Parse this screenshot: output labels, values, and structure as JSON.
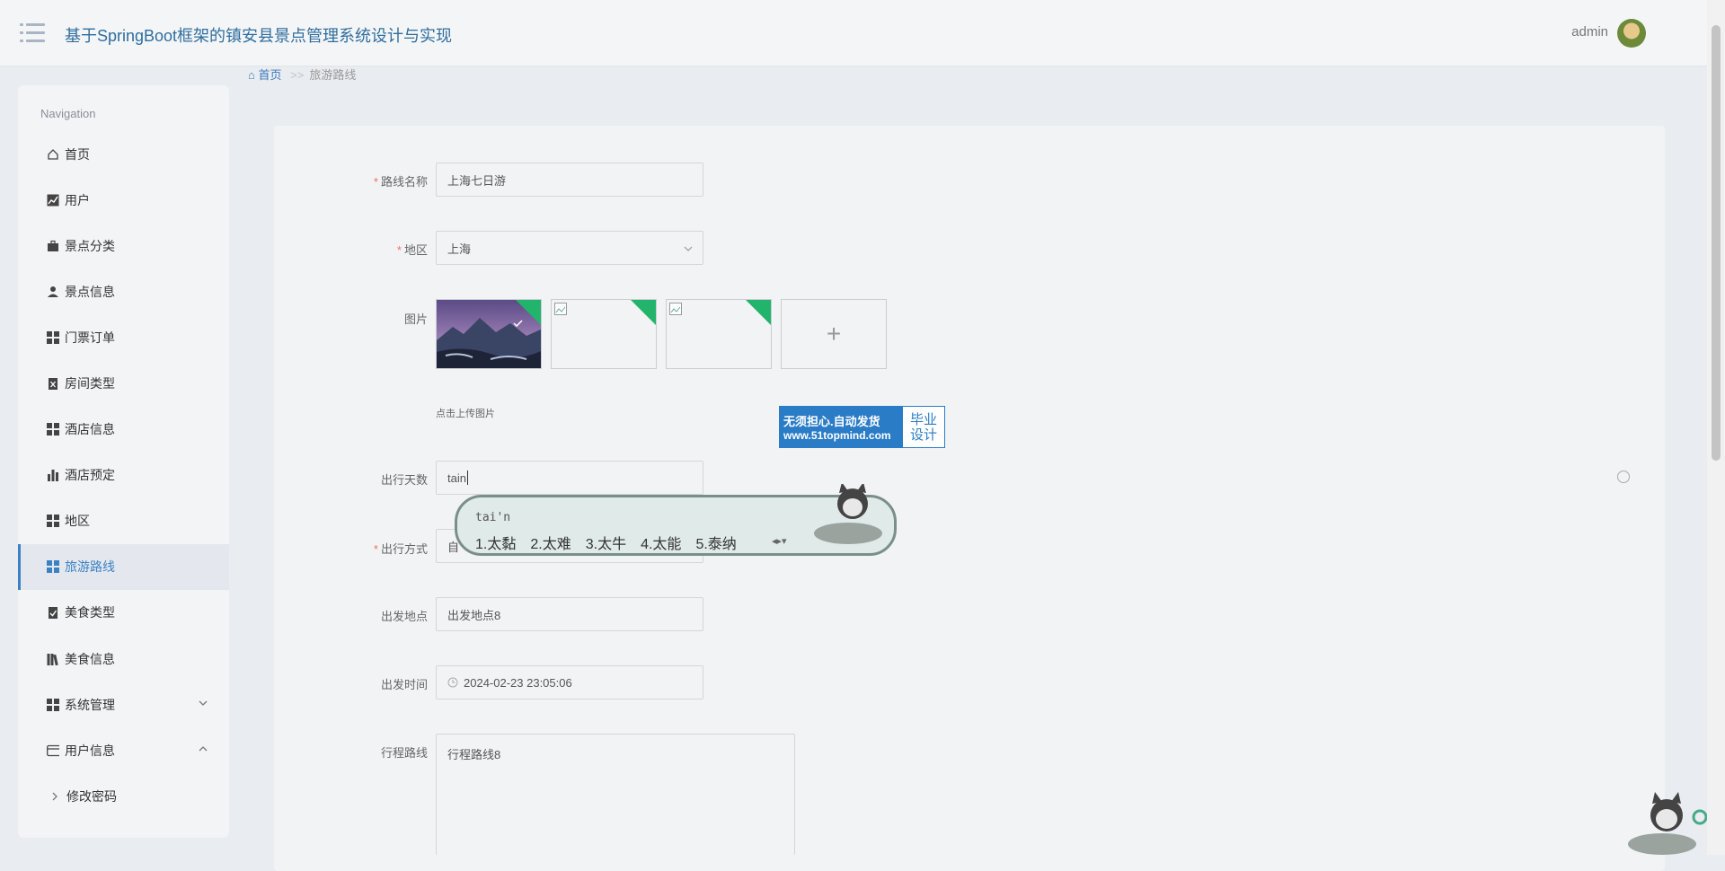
{
  "header": {
    "title": "基于SpringBoot框架的镇安县景点管理系统设计与实现",
    "user": "admin"
  },
  "breadcrumb": {
    "home": "首页",
    "separator": ">>",
    "current": "旅游路线"
  },
  "sidebar": {
    "title": "Navigation",
    "items": [
      {
        "label": "首页",
        "icon": "home-icon"
      },
      {
        "label": "用户",
        "icon": "chart-line-icon"
      },
      {
        "label": "景点分类",
        "icon": "briefcase-icon"
      },
      {
        "label": "景点信息",
        "icon": "person-icon"
      },
      {
        "label": "门票订单",
        "icon": "grid-icon"
      },
      {
        "label": "房间类型",
        "icon": "clipboard-icon"
      },
      {
        "label": "酒店信息",
        "icon": "grid-icon"
      },
      {
        "label": "酒店预定",
        "icon": "bar-chart-icon"
      },
      {
        "label": "地区",
        "icon": "grid-icon"
      },
      {
        "label": "旅游路线",
        "icon": "grid-icon",
        "active": true
      },
      {
        "label": "美食类型",
        "icon": "clipboard-check-icon"
      },
      {
        "label": "美食信息",
        "icon": "books-icon"
      },
      {
        "label": "系统管理",
        "icon": "grid-icon",
        "arrow": "chevron-down-icon"
      },
      {
        "label": "用户信息",
        "icon": "card-icon",
        "arrow": "chevron-up-icon"
      },
      {
        "label": "修改密码",
        "icon": "chevron-right-icon",
        "sub": true
      }
    ]
  },
  "form": {
    "route_name": {
      "label": "路线名称",
      "required": true,
      "value": "上海七日游"
    },
    "region": {
      "label": "地区",
      "required": true,
      "value": "上海"
    },
    "images": {
      "label": "图片",
      "hint": "点击上传图片",
      "add": "+"
    },
    "days": {
      "label": "出行天数",
      "value": "tain"
    },
    "travel_mode": {
      "label": "出行方式",
      "required": true,
      "value": "自"
    },
    "departure_place": {
      "label": "出发地点",
      "value": "出发地点8"
    },
    "departure_time": {
      "label": "出发时间",
      "value": "2024-02-23 23:05:06"
    },
    "itinerary": {
      "label": "行程路线",
      "value": "行程路线8"
    }
  },
  "ad": {
    "line1": "无须担心.自动发货",
    "line2": "www.51topmind.com",
    "right1": "毕业",
    "right2": "设计"
  },
  "ime": {
    "pinyin": "tai'n",
    "candidates": [
      "1.太黏",
      "2.太难",
      "3.太牛",
      "4.太能",
      "5.泰纳"
    ]
  },
  "colors": {
    "accent": "#3b82c4",
    "title": "#2f6e9f",
    "required": "#f56c6c",
    "upload_badge": "#23b46b"
  }
}
